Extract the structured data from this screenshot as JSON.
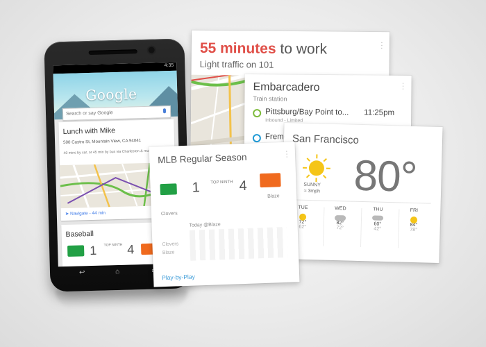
{
  "phone": {
    "status_time": "4:35",
    "logo": "Google",
    "search_placeholder": "Search or say Google",
    "card1": {
      "title": "Lunch with Mike",
      "address": "500 Castro St, Mountain View, CA 94041",
      "subtitle": "40 mins by car, or 45 min by bus via Charleston & muff Sword",
      "navigate": "Navigate - 44 min"
    },
    "card2": {
      "title": "Baseball",
      "away_score": "1",
      "inning": "TOP NINTH",
      "home_score": "4"
    }
  },
  "traffic": {
    "minutes": "55 minutes",
    "rest": "to work",
    "sub": "Light traffic on 101"
  },
  "transit": {
    "station": "Embarcadero",
    "station_type": "Train station",
    "rows": [
      {
        "destination": "Pittsburg/Bay Point to...",
        "time": "11:25pm",
        "note": "Inbound - Limited",
        "color": "#7dbb3b"
      },
      {
        "destination": "Fremont",
        "time": "",
        "note": "",
        "color": "#1f9ad6"
      }
    ]
  },
  "weather": {
    "city": "San Francisco",
    "temp": "80°",
    "condition": "SUNNY",
    "wind": "3mph",
    "forecast": [
      {
        "day": "TUE",
        "hi": "72°",
        "lo": "62°",
        "icon": "sun-icon"
      },
      {
        "day": "WED",
        "hi": "82°",
        "lo": "72°",
        "icon": "cloud-icon"
      },
      {
        "day": "THU",
        "hi": "60°",
        "lo": "42°",
        "icon": "rain-icon"
      },
      {
        "day": "FRI",
        "hi": "84°",
        "lo": "78°",
        "icon": "sun-icon"
      }
    ]
  },
  "mlb": {
    "title": "MLB Regular Season",
    "away_score": "1",
    "inning": "TOP NINTH",
    "home_score": "4",
    "away_team": "Clovers",
    "home_team": "Blaze",
    "grid_header": "Today @Blaze",
    "grid_rows": [
      "Clovers",
      "Blaze"
    ],
    "play_by_play": "Play-by-Play"
  },
  "colors": {
    "accent_red": "#e04f48",
    "link_blue": "#3b9bd8",
    "clovers_green": "#22a045",
    "blaze_orange": "#f06a1e",
    "sun_yellow": "#f5c518"
  }
}
